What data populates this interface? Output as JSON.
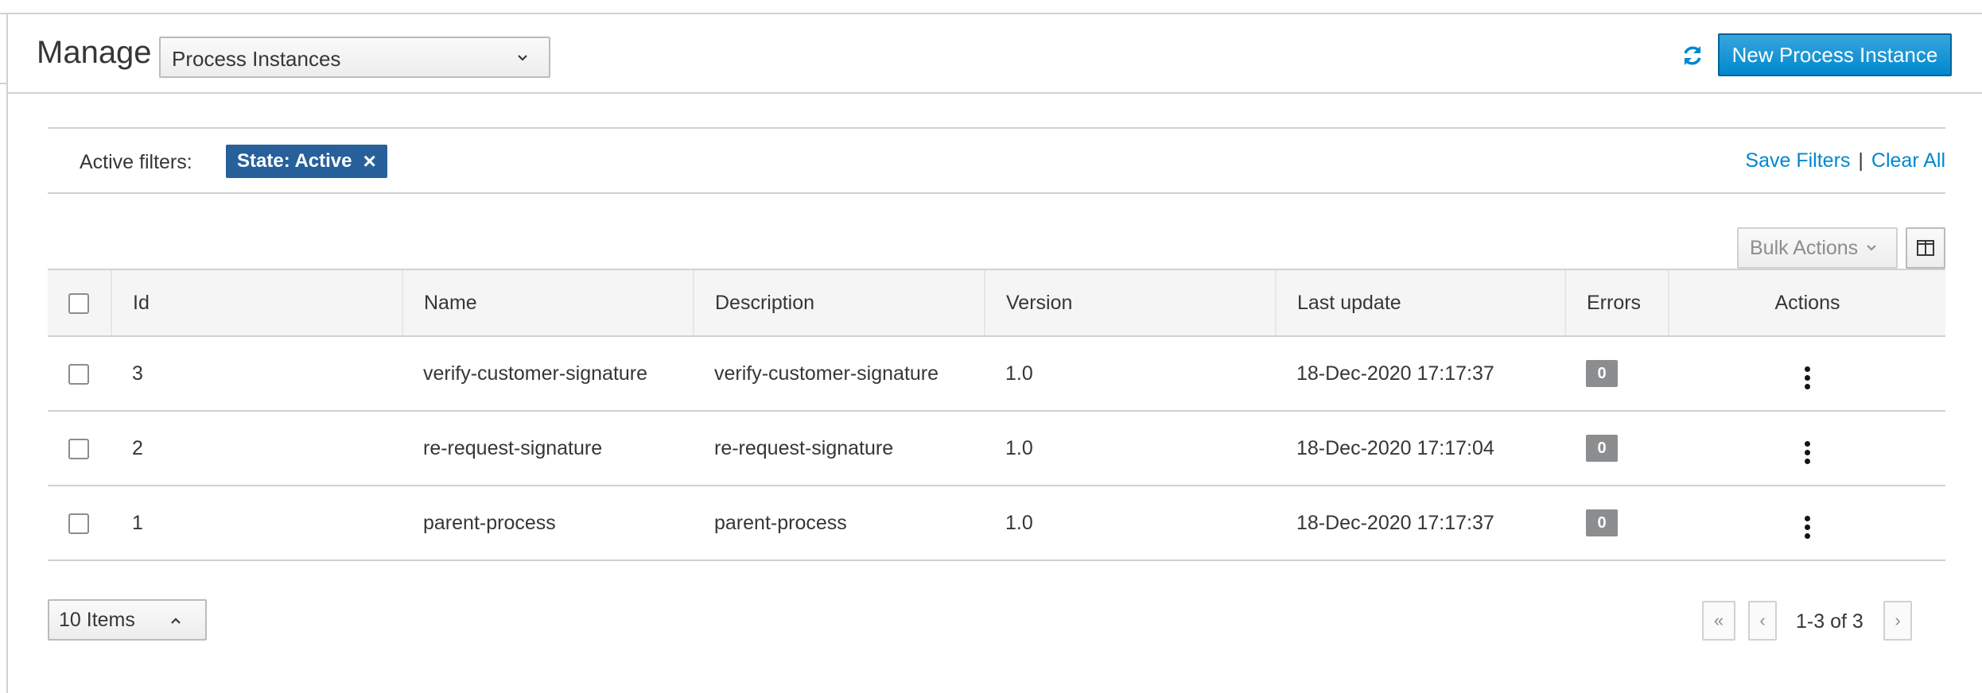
{
  "header": {
    "title": "Manage",
    "select_value": "Process Instances",
    "new_button_label": "New Process Instance"
  },
  "filters": {
    "label": "Active filters:",
    "chip_label": "State: Active",
    "chip_close": "×",
    "save_label": "Save Filters",
    "separator": "|",
    "clear_label": "Clear All"
  },
  "toolbar": {
    "bulk_label": "Bulk Actions"
  },
  "table": {
    "columns": [
      "Id",
      "Name",
      "Description",
      "Version",
      "Last update",
      "Errors",
      "Actions"
    ],
    "rows": [
      {
        "id": "3",
        "name": "verify-customer-signature",
        "description": "verify-customer-signature",
        "version": "1.0",
        "last_update": "18-Dec-2020 17:17:37",
        "errors": "0"
      },
      {
        "id": "2",
        "name": "re-request-signature",
        "description": "re-request-signature",
        "version": "1.0",
        "last_update": "18-Dec-2020 17:17:04",
        "errors": "0"
      },
      {
        "id": "1",
        "name": "parent-process",
        "description": "parent-process",
        "version": "1.0",
        "last_update": "18-Dec-2020 17:17:37",
        "errors": "0"
      }
    ]
  },
  "pagination": {
    "per_page_label": "10 Items",
    "range_text": "1-3 of 3",
    "first_glyph": "«",
    "prev_glyph": "‹",
    "next_glyph": "›"
  },
  "colors": {
    "primary": "#0088ce",
    "chip": "#27609b",
    "badge": "#8b8d8f"
  },
  "icons": [
    "refresh-icon",
    "chevron-down-icon",
    "close-icon",
    "column-toggle-icon",
    "kebab-icon",
    "chevron-up-icon"
  ]
}
